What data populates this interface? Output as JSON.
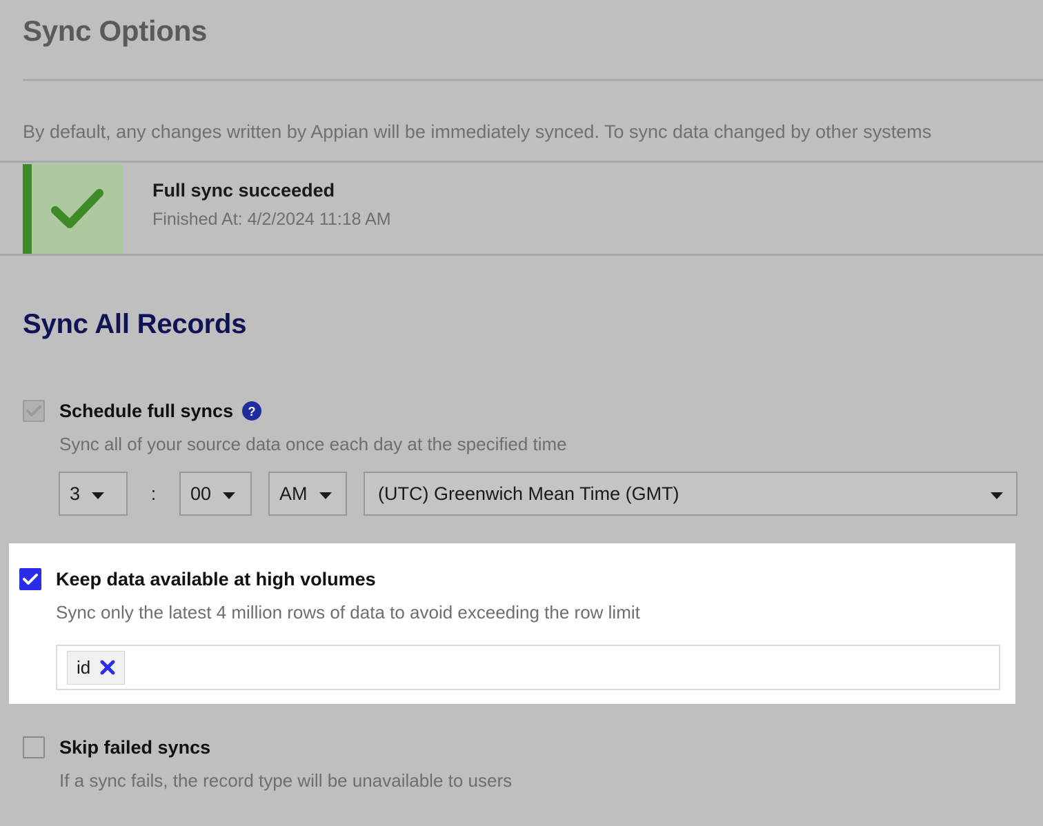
{
  "page": {
    "title": "Sync Options",
    "intro": "By default, any changes written by Appian will be immediately synced. To sync data changed by other systems"
  },
  "status_banner": {
    "icon": "check-icon",
    "title": "Full sync succeeded",
    "subtitle": "Finished At: 4/2/2024 11:18 AM",
    "accent_color": "#3d8b27",
    "fill_color": "#aec8a0"
  },
  "sync_all_records": {
    "heading": "Sync All Records",
    "heading_color": "#101354",
    "schedule": {
      "label": "Schedule full syncs",
      "description": "Sync all of your source data once each day at the specified time",
      "checked": true,
      "disabled": true,
      "help_icon": "help-circle-icon",
      "help_icon_color": "#1f2b9e",
      "hour": "3",
      "separator": ":",
      "minute": "00",
      "meridiem": "AM",
      "timezone": "(UTC) Greenwich Mean Time (GMT)"
    },
    "high_volume": {
      "label": "Keep data available at high volumes",
      "description": "Sync only the latest 4 million rows of data to avoid exceeding the row limit",
      "checked": true,
      "checkbox_color": "#2b2bea",
      "chips": [
        {
          "label": "id",
          "remove_icon": "close-icon",
          "remove_icon_color": "#2b2bea"
        }
      ]
    },
    "skip_failed": {
      "label": "Skip failed syncs",
      "description": "If a sync fails, the record type will be unavailable to users",
      "checked": false
    }
  }
}
